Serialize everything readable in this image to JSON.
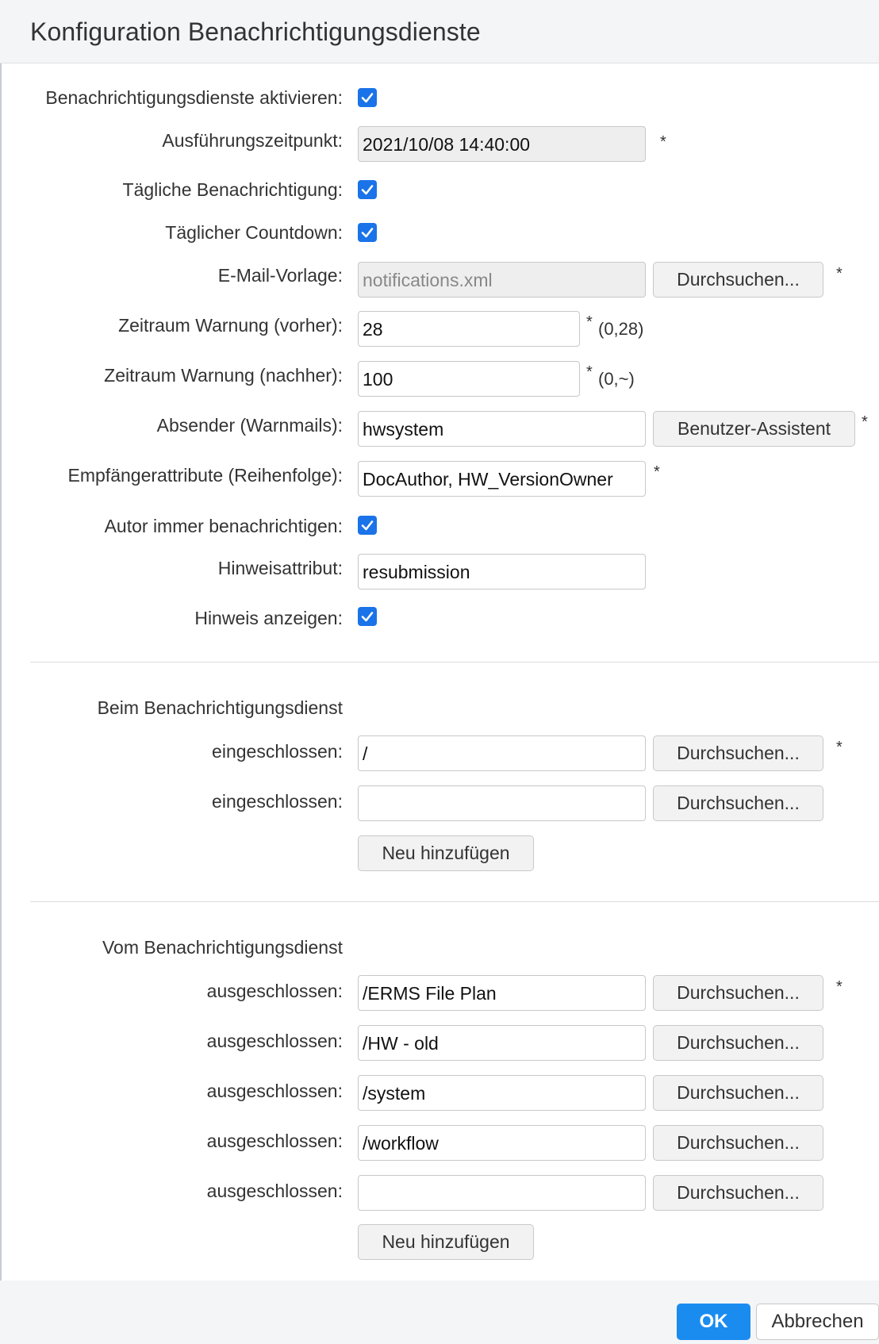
{
  "dialog": {
    "title": "Konfiguration Benachrichtigungsdienste"
  },
  "form": {
    "activate": {
      "label": "Benachrichtigungsdienste aktivieren:",
      "checked": true
    },
    "execution_time": {
      "label": "Ausführungszeitpunkt:",
      "value": "2021/10/08 14:40:00",
      "required": "*"
    },
    "daily_notification": {
      "label": "Tägliche Benachrichtigung:",
      "checked": true
    },
    "daily_countdown": {
      "label": "Täglicher Countdown:",
      "checked": true
    },
    "email_template": {
      "label": "E-Mail-Vorlage:",
      "value": "notifications.xml",
      "browse_label": "Durchsuchen...",
      "required": "*"
    },
    "warning_before": {
      "label": "Zeitraum Warnung (vorher):",
      "value": "28",
      "required": "*",
      "range": "(0,28)"
    },
    "warning_after": {
      "label": "Zeitraum Warnung (nachher):",
      "value": "100",
      "required": "*",
      "range": "(0,~)"
    },
    "sender": {
      "label": "Absender (Warnmails):",
      "value": "hwsystem",
      "wizard_label": "Benutzer-Assistent",
      "required": "*"
    },
    "recipient_attributes": {
      "label": "Empfängerattribute (Reihenfolge):",
      "value": "DocAuthor, HW_VersionOwner",
      "required": "*"
    },
    "always_notify_author": {
      "label": "Autor immer benachrichtigen:",
      "checked": true
    },
    "hint_attribute": {
      "label": "Hinweisattribut:",
      "value": "resubmission"
    },
    "show_hint": {
      "label": "Hinweis anzeigen:",
      "checked": true
    }
  },
  "included": {
    "section_title": "Beim Benachrichtigungsdienst",
    "rows": [
      {
        "label": "eingeschlossen:",
        "value": "/",
        "browse_label": "Durchsuchen...",
        "required": "*"
      },
      {
        "label": "eingeschlossen:",
        "value": "",
        "browse_label": "Durchsuchen..."
      }
    ],
    "add_label": "Neu hinzufügen"
  },
  "excluded": {
    "section_title": "Vom Benachrichtigungsdienst",
    "rows": [
      {
        "label": "ausgeschlossen:",
        "value": "/ERMS File Plan",
        "browse_label": "Durchsuchen...",
        "required": "*"
      },
      {
        "label": "ausgeschlossen:",
        "value": "/HW - old",
        "browse_label": "Durchsuchen..."
      },
      {
        "label": "ausgeschlossen:",
        "value": "/system",
        "browse_label": "Durchsuchen..."
      },
      {
        "label": "ausgeschlossen:",
        "value": "/workflow",
        "browse_label": "Durchsuchen..."
      },
      {
        "label": "ausgeschlossen:",
        "value": "",
        "browse_label": "Durchsuchen..."
      }
    ],
    "add_label": "Neu hinzufügen"
  },
  "footer": {
    "ok_label": "OK",
    "cancel_label": "Abbrechen"
  },
  "colors": {
    "accent": "#1a73e8",
    "ok_button": "#1a8cf0",
    "header_bg": "#f4f5f7"
  }
}
